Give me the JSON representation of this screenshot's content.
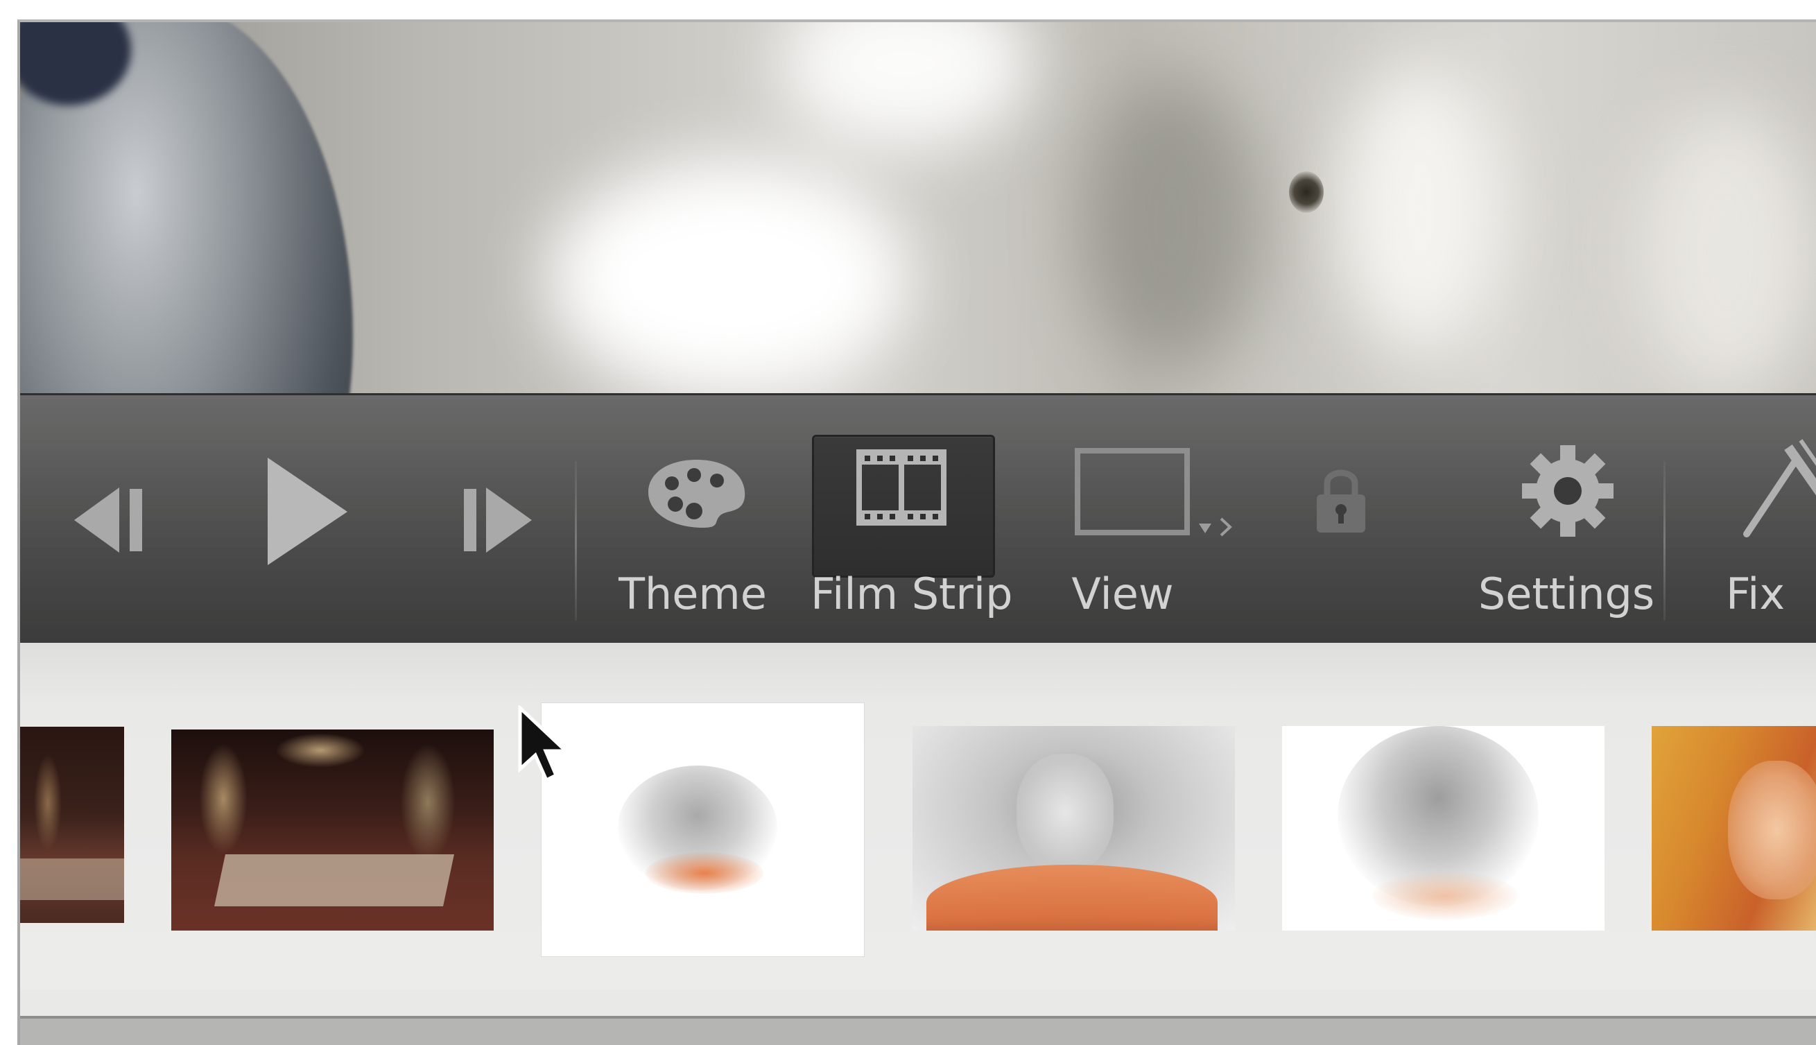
{
  "app": {
    "name": "slideshow-editor"
  },
  "toolbar": {
    "buttons": [
      {
        "id": "previous",
        "label": "",
        "icon": "skip-back-icon"
      },
      {
        "id": "play",
        "label": "",
        "icon": "play-icon"
      },
      {
        "id": "next",
        "label": "",
        "icon": "skip-forward-icon"
      },
      {
        "id": "theme",
        "label": "Theme",
        "icon": "palette-icon"
      },
      {
        "id": "film-strip",
        "label": "Film Strip",
        "icon": "film-strip-icon",
        "active": true
      },
      {
        "id": "view",
        "label": "View",
        "icon": "view-rectangle-icon"
      },
      {
        "id": "lock",
        "label": "",
        "icon": "lock-icon"
      },
      {
        "id": "settings",
        "label": "Settings",
        "icon": "gear-icon"
      },
      {
        "id": "fix",
        "label": "Fix",
        "icon": "fix-wand-icon"
      }
    ]
  },
  "filmstrip": {
    "slides": [
      {
        "id": "slide-1",
        "subject": "dark hall (cropped)"
      },
      {
        "id": "slide-2",
        "subject": "candlelit gothic hall"
      },
      {
        "id": "slide-3",
        "subject": "faded sketch portrait",
        "selected": true
      },
      {
        "id": "slide-4",
        "subject": "pencil sketch portrait with orange top"
      },
      {
        "id": "slide-5",
        "subject": "light sketch portrait"
      },
      {
        "id": "slide-6",
        "subject": "color portrait (cropped)"
      }
    ]
  },
  "colors": {
    "toolbar_bg": "#3a3a3a",
    "toolbar_text": "#d2d2d2",
    "strip_bg": "#e9e9e8",
    "selected_frame": "#ffffff"
  }
}
